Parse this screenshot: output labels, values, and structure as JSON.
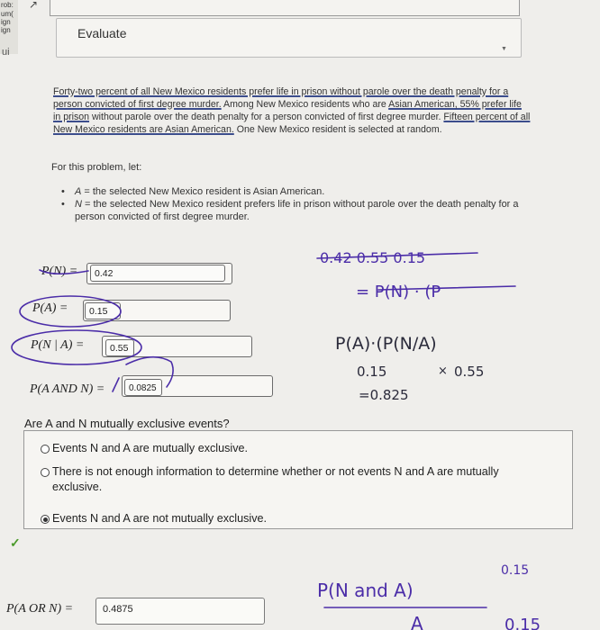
{
  "left_strip": {
    "lines": [
      "rob:",
      "um(",
      "ign",
      "ign"
    ],
    "partial": "ui"
  },
  "evaluate": {
    "label": "Evaluate"
  },
  "problem": {
    "p1": "Forty-two percent of all New Mexico residents prefer life in prison without parole over the death penalty for a person convicted of first degree murder.",
    "p2": " Among New Mexico residents who are ",
    "p3": "Asian American, 55% prefer life in prison",
    "p4": " without parole over the death penalty for a person convicted of first degree murder. ",
    "p5": "Fifteen percent of all New Mexico residents are Asian American.",
    "p6": " One New Mexico resident is selected at random."
  },
  "let_line": "For this problem, let:",
  "bullets": [
    {
      "var": "A",
      "text": " = the selected New Mexico resident is Asian American."
    },
    {
      "var": "N",
      "text": " = the selected New Mexico resident prefers life in prison without parole over the death penalty for a person convicted of first degree murder."
    }
  ],
  "probs": {
    "pn": {
      "label": "P(N) =",
      "value": "0.42"
    },
    "pa": {
      "label": "P(A) =",
      "value": "0.15"
    },
    "pna": {
      "label": "P(N | A) =",
      "value": "0.55"
    },
    "pand": {
      "label": "P(A AND N) =",
      "value": "0.0825"
    },
    "por": {
      "label": "P(A OR N) =",
      "value": "0.4875"
    }
  },
  "question": "Are A and N mutually exclusive events?",
  "options": [
    {
      "text": "Events N and A are mutually exclusive.",
      "selected": false
    },
    {
      "text": "There is not enough information to determine whether or not events N and A are mutually exclusive.",
      "selected": false
    },
    {
      "text": "Events N and A are not mutually exclusive.",
      "selected": true
    }
  ],
  "handwriting": {
    "line1": "0.42 0.55  0.15",
    "line3": "P(A)·(P(N/A)",
    "line4a": "0.15",
    "line4b": "0.55",
    "line5": "=0.825",
    "line6": "P(N and A)",
    "line6b": "0.15",
    "line7a": "A",
    "line7b": "0.15"
  },
  "colors": {
    "ink": "#4b2da8",
    "check": "#4a9a2a",
    "background": "#efeeeb"
  }
}
